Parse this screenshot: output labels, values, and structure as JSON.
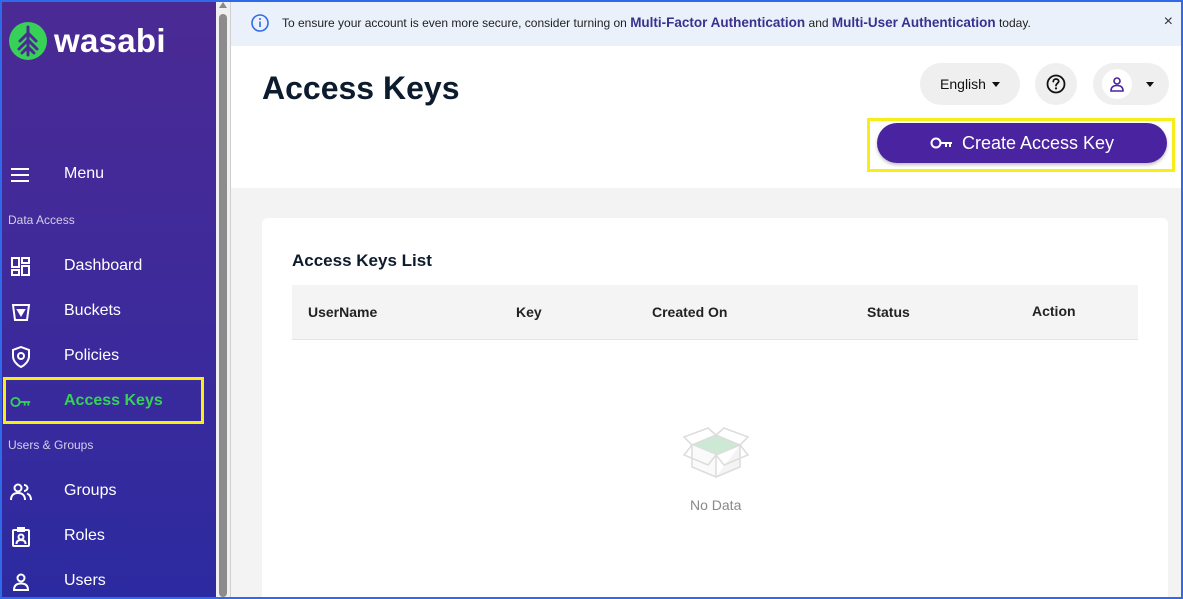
{
  "brand": {
    "name": "wasabi",
    "accent": "#37d158",
    "sidebar_color": "#4b2a94"
  },
  "sidebar": {
    "menu_label": "Menu",
    "sections": {
      "data_access": "Data Access",
      "users_groups": "Users & Groups"
    },
    "items": [
      {
        "label": "Dashboard",
        "icon": "dashboard-icon"
      },
      {
        "label": "Buckets",
        "icon": "bucket-icon"
      },
      {
        "label": "Policies",
        "icon": "shield-icon"
      },
      {
        "label": "Access Keys",
        "icon": "key-icon",
        "active": true
      },
      {
        "label": "Groups",
        "icon": "group-icon"
      },
      {
        "label": "Roles",
        "icon": "badge-icon"
      },
      {
        "label": "Users",
        "icon": "user-icon"
      }
    ]
  },
  "banner": {
    "text_before": "To ensure your account is even more secure, consider turning on ",
    "link1": "Multi-Factor Authentication",
    "text_mid": " and ",
    "link2": "Multi-User Authentication",
    "text_after": " today.",
    "close": "×"
  },
  "header": {
    "title": "Access Keys",
    "language": "English",
    "create_button": "Create Access Key"
  },
  "table": {
    "title": "Access Keys List",
    "columns": [
      "UserName",
      "Key",
      "Created On",
      "Status",
      "Action"
    ],
    "rows": [],
    "empty_text": "No Data"
  }
}
